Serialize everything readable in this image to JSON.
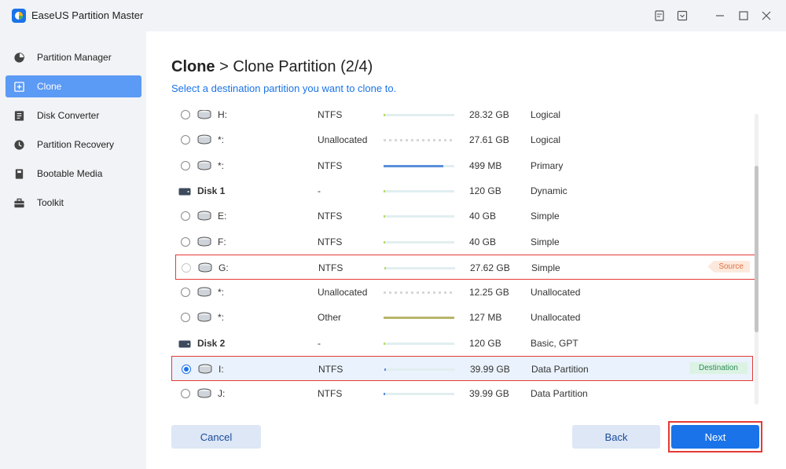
{
  "app": {
    "title": "EaseUS Partition Master"
  },
  "sidebar": {
    "items": [
      {
        "label": "Partition Manager",
        "icon": "pie-chart-icon"
      },
      {
        "label": "Clone",
        "icon": "clone-icon",
        "active": true
      },
      {
        "label": "Disk Converter",
        "icon": "disk-converter-icon"
      },
      {
        "label": "Partition Recovery",
        "icon": "recovery-icon"
      },
      {
        "label": "Bootable Media",
        "icon": "bootable-media-icon"
      },
      {
        "label": "Toolkit",
        "icon": "toolkit-icon"
      }
    ]
  },
  "header": {
    "title_bold": "Clone",
    "title_sep": ">",
    "title_step": "Clone Partition (2/4)",
    "subtitle": "Select a destination partition you want to clone to."
  },
  "rows": [
    {
      "kind": "partition",
      "name": "H:",
      "fs": "NTFS",
      "size": "28.32 GB",
      "type": "Logical",
      "usage": 0.01,
      "bar_style": "light"
    },
    {
      "kind": "partition",
      "name": "*:",
      "fs": "Unallocated",
      "size": "27.61 GB",
      "type": "Logical",
      "usage": 0,
      "bar_style": "dashed"
    },
    {
      "kind": "partition",
      "name": "*:",
      "fs": "NTFS",
      "size": "499 MB",
      "type": "Primary",
      "usage": 0.84,
      "bar_style": "blue"
    },
    {
      "kind": "disk",
      "name": "Disk 1",
      "fs": "-",
      "size": "120 GB",
      "type": "Dynamic",
      "usage": 0.02,
      "bar_style": "light"
    },
    {
      "kind": "partition",
      "name": "E:",
      "fs": "NTFS",
      "size": "40 GB",
      "type": "Simple",
      "usage": 0.02,
      "bar_style": "light"
    },
    {
      "kind": "partition",
      "name": "F:",
      "fs": "NTFS",
      "size": "40 GB",
      "type": "Simple",
      "usage": 0.02,
      "bar_style": "light"
    },
    {
      "kind": "partition",
      "name": "G:",
      "fs": "NTFS",
      "size": "27.62 GB",
      "type": "Simple",
      "usage": 0.02,
      "bar_style": "light",
      "tag": "Source"
    },
    {
      "kind": "partition",
      "name": "*:",
      "fs": "Unallocated",
      "size": "12.25 GB",
      "type": "Unallocated",
      "usage": 0,
      "bar_style": "dashed"
    },
    {
      "kind": "partition",
      "name": "*:",
      "fs": "Other",
      "size": "127 MB",
      "type": "Unallocated",
      "usage": 1.0,
      "bar_style": "olive"
    },
    {
      "kind": "disk",
      "name": "Disk 2",
      "fs": "-",
      "size": "120 GB",
      "type": "Basic, GPT",
      "usage": 0.02,
      "bar_style": "light"
    },
    {
      "kind": "partition",
      "name": "I:",
      "fs": "NTFS",
      "size": "39.99 GB",
      "type": "Data Partition",
      "usage": 0.01,
      "bar_style": "blue-small",
      "tag": "Destination",
      "selected": true
    },
    {
      "kind": "partition",
      "name": "J:",
      "fs": "NTFS",
      "size": "39.99 GB",
      "type": "Data Partition",
      "usage": 0.01,
      "bar_style": "blue-small"
    }
  ],
  "buttons": {
    "cancel": "Cancel",
    "back": "Back",
    "next": "Next"
  },
  "colors": {
    "accent": "#1a73e8",
    "highlight": "#e53935",
    "sidebar_active": "#5b9af5"
  }
}
